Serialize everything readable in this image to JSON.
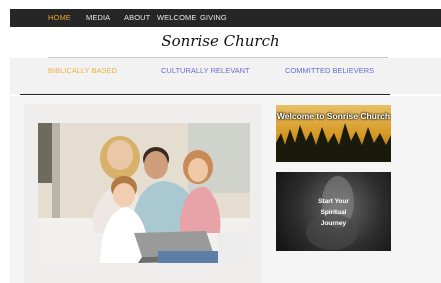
{
  "nav": {
    "items": [
      {
        "label": "HOME",
        "active": true
      },
      {
        "label": "MEDIA",
        "active": false
      },
      {
        "label": "ABOUT",
        "active": false
      },
      {
        "label": "WELCOME",
        "active": false
      },
      {
        "label": "GIVING",
        "active": false
      }
    ]
  },
  "site": {
    "title": "Sonrise Church"
  },
  "taglines": [
    {
      "text": "BIBLICALLY BASED",
      "color": "#f0b040"
    },
    {
      "text": "CULTURALLY RELEVANT",
      "color": "#6a6ad0"
    },
    {
      "text": "COMMITTED BELIEVERS",
      "color": "#5a70d0"
    }
  ],
  "banners": {
    "welcome": {
      "label": "Welcome to Sonrise Church"
    },
    "journey": {
      "line1": "Start Your",
      "line2": "Spiritual",
      "line3": "Journey"
    }
  },
  "colors": {
    "nav_bg": "#262626",
    "nav_active": "#f0a030",
    "nav_text": "#e8e8e8"
  }
}
